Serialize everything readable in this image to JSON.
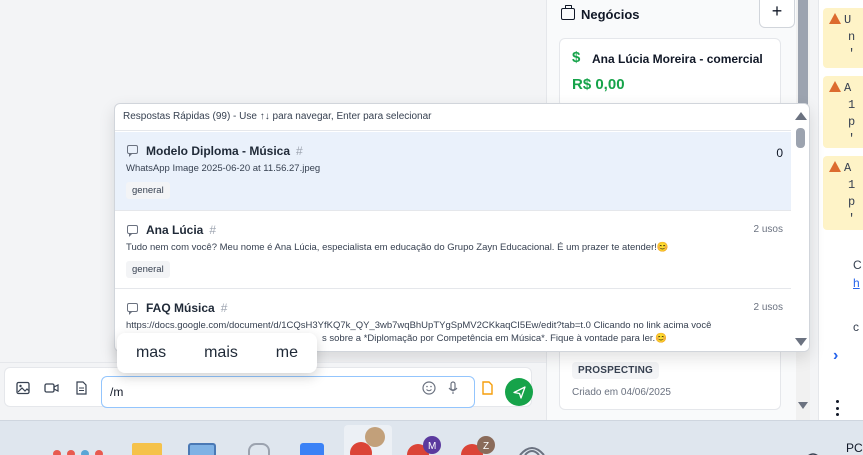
{
  "business_panel": {
    "title": "Negócios",
    "add_label": "+",
    "deal": {
      "name": "Ana Lúcia Moreira - comercial",
      "currency_symbol": "$",
      "value": "R$ 0,00"
    },
    "deal_footer": {
      "stage": "PROSPECTING",
      "created": "Criado em 04/06/2025"
    }
  },
  "alerts": [
    {
      "lines": [
        "U",
        "n",
        "'"
      ]
    },
    {
      "lines": [
        "A",
        "1",
        "p",
        "'"
      ]
    },
    {
      "lines": [
        "A",
        "1",
        "p",
        "'"
      ]
    }
  ],
  "alerts_misc": {
    "line1": "C",
    "line2": "h",
    "line3": "c"
  },
  "quick_replies": {
    "header": "Respostas Rápidas (99) - Use ↑↓ para navegar, Enter para selecionar",
    "items": [
      {
        "title": "Modelo Diploma - Música",
        "hash": "#",
        "meta": "0",
        "desc": "WhatsApp Image 2025-06-20 at 11.56.27.jpeg",
        "tag": "general"
      },
      {
        "title": "Ana Lúcia",
        "hash": "#",
        "meta": "2 usos",
        "desc": "Tudo nem com você? Meu nome é Ana Lúcia, especialista em educação do Grupo Zayn Educacional. É um prazer te atender!😊",
        "tag": "general"
      },
      {
        "title": "FAQ Música",
        "hash": "#",
        "meta": "2 usos",
        "desc": "https://docs.google.com/document/d/1CQsH3YfKQ7k_QY_3wb7wqBhUpTYgSpMV2CKkaqCI5Ew/edit?tab=t.0 Clicando no link acima você",
        "desc2": "s sobre a *Diplomação por Competência em Música*. Fique à vontade para ler.😊"
      }
    ]
  },
  "suggestions": [
    "mas",
    "mais",
    "me"
  ],
  "composer": {
    "input_value": "/m"
  },
  "taskbar": {
    "right_text": "PC"
  },
  "colors": {
    "accent_green": "#16a34a",
    "selected_row": "#eaf1fb",
    "warning_bg": "#fef3c7"
  }
}
